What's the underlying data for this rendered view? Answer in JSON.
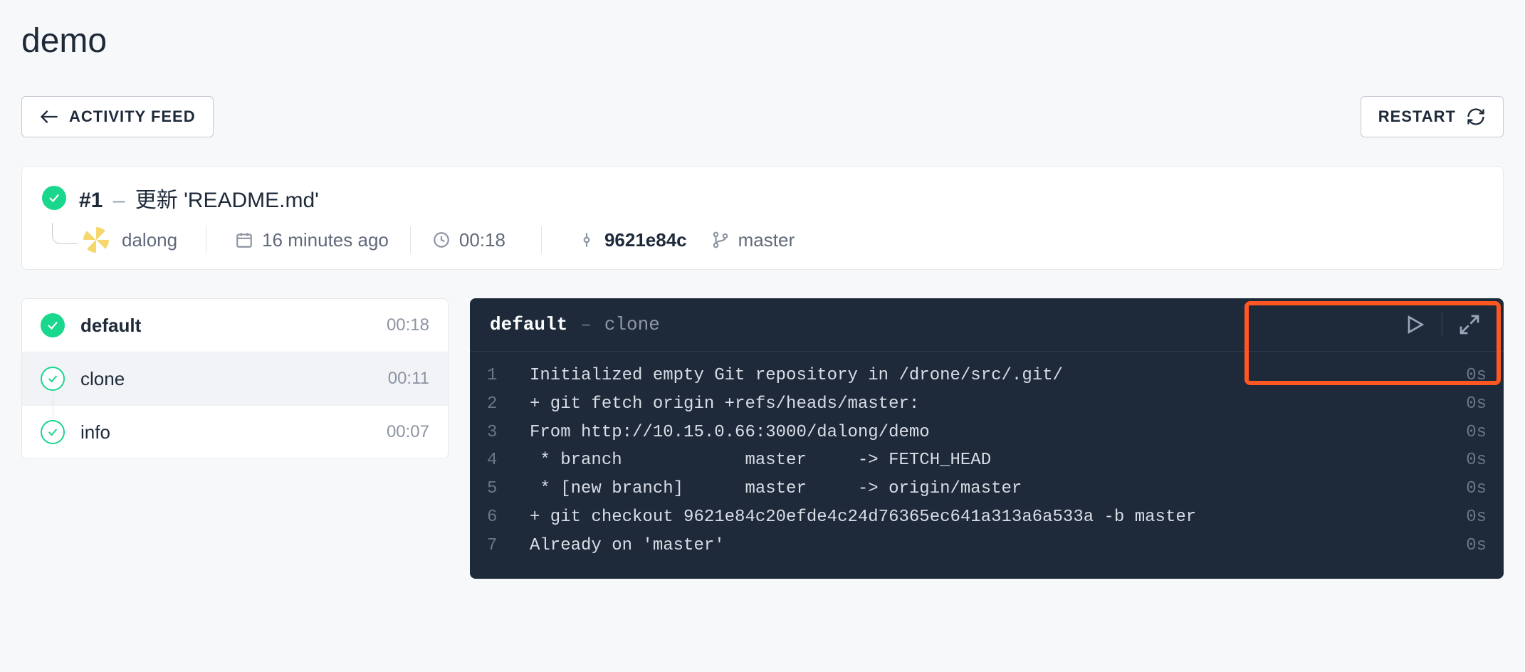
{
  "page": {
    "title": "demo"
  },
  "toolbar": {
    "activity_feed_label": "ACTIVITY FEED",
    "restart_label": "RESTART"
  },
  "build": {
    "number": "#1",
    "dash": "–",
    "message": "更新 'README.md'",
    "author": "dalong",
    "time_ago": "16 minutes ago",
    "duration": "00:18",
    "commit": "9621e84c",
    "branch": "master"
  },
  "steps": {
    "stage": {
      "name": "default",
      "time": "00:18"
    },
    "items": [
      {
        "name": "clone",
        "time": "00:11"
      },
      {
        "name": "info",
        "time": "00:07"
      }
    ]
  },
  "log": {
    "stage": "default",
    "dash": "–",
    "step": "clone",
    "lines": [
      {
        "n": "1",
        "t": "Initialized empty Git repository in /drone/src/.git/",
        "d": "0s"
      },
      {
        "n": "2",
        "t": "+ git fetch origin +refs/heads/master:",
        "d": "0s"
      },
      {
        "n": "3",
        "t": "From http://10.15.0.66:3000/dalong/demo",
        "d": "0s"
      },
      {
        "n": "4",
        "t": " * branch            master     -> FETCH_HEAD",
        "d": "0s"
      },
      {
        "n": "5",
        "t": " * [new branch]      master     -> origin/master",
        "d": "0s"
      },
      {
        "n": "6",
        "t": "+ git checkout 9621e84c20efde4c24d76365ec641a313a6a533a -b master",
        "d": "0s"
      },
      {
        "n": "7",
        "t": "Already on 'master'",
        "d": "0s"
      }
    ]
  }
}
